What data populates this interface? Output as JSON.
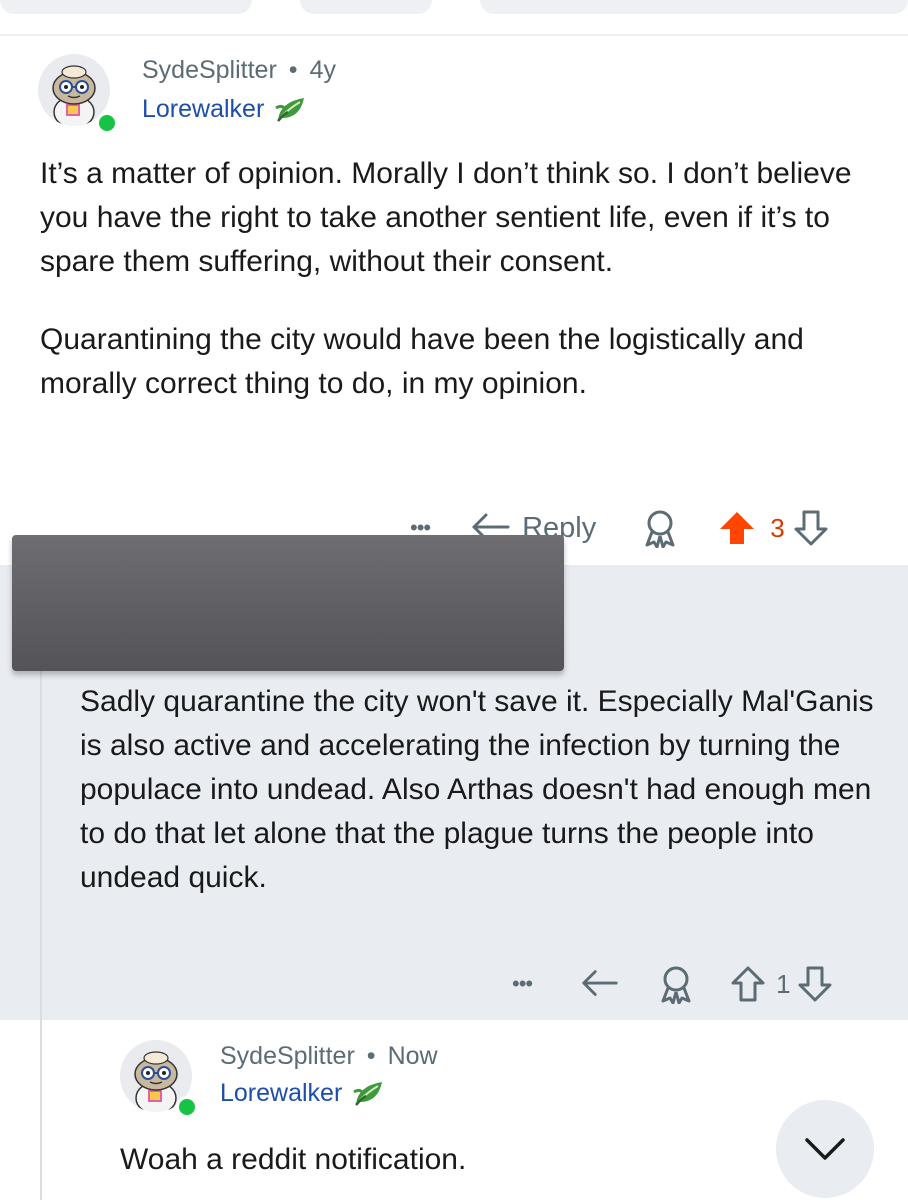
{
  "comments": [
    {
      "username": "SydeSplitter",
      "separator": "•",
      "age": "4y",
      "flair": "Lorewalker",
      "flair_icon": "leaf-icon",
      "paragraphs": [
        "It’s a matter of opinion. Morally I don’t think so. I don’t believe you have the right to take another sentient life, even if it’s to spare them suffering, without their consent.",
        "Quarantining the city would have been the logistically and morally correct thing to do, in my opinion."
      ],
      "actions": {
        "more": "•••",
        "reply_label": "Reply",
        "score": "3",
        "upvoted": true
      }
    },
    {
      "username_redacted": true,
      "paragraphs": [
        "Sadly quarantine the city won't save it. Especially Mal'Ganis is also active and accelerating the infection by turning the populace into undead. Also Arthas doesn't had enough men to do that let alone that the plague turns the people into undead quick."
      ],
      "actions": {
        "more": "•••",
        "score": "1",
        "upvoted": false
      }
    },
    {
      "username": "SydeSplitter",
      "separator": "•",
      "age": "Now",
      "flair": "Lorewalker",
      "flair_icon": "leaf-icon",
      "paragraphs": [
        "Woah a reddit notification."
      ]
    }
  ],
  "colors": {
    "upvote_active": "#ff4500",
    "score_active": "#d93a00",
    "flair_text": "#1d4fa8",
    "meta_text": "#5c6c74",
    "online": "#16c344",
    "highlight_bg": "#e9ecf0"
  },
  "scroll_button_icon": "chevron-down-icon"
}
